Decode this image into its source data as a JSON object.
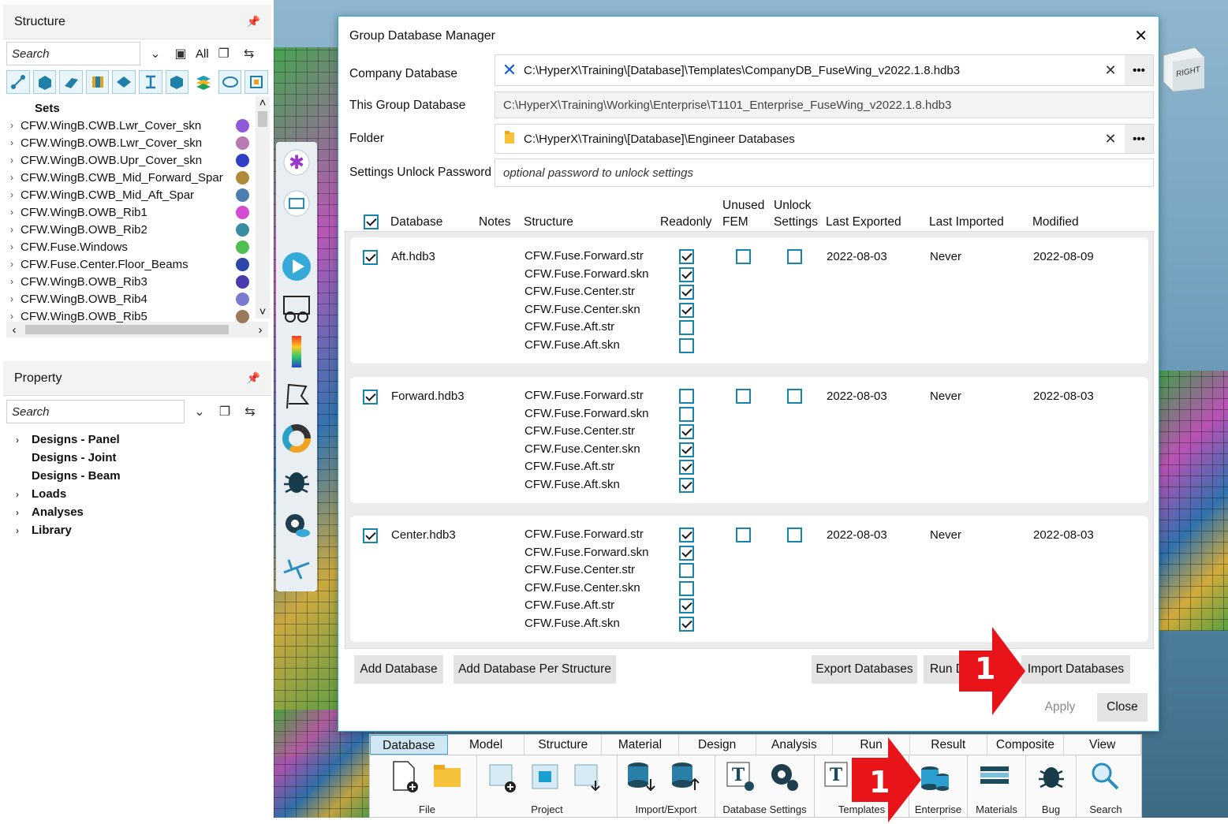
{
  "structure_panel": {
    "title": "Structure",
    "search_placeholder": "Search",
    "filter_label": "All",
    "tree": [
      {
        "label": "Sets",
        "bold": true,
        "expandable": false,
        "color": ""
      },
      {
        "label": "CFW.WingB.CWB.Lwr_Cover_skn",
        "color": "#8e5ad8"
      },
      {
        "label": "CFW.WingB.OWB.Lwr_Cover_skn",
        "color": "#b87ab0"
      },
      {
        "label": "CFW.WingB.OWB.Upr_Cover_skn",
        "color": "#2f3fc8"
      },
      {
        "label": "CFW.WingB.CWB_Mid_Forward_Spar",
        "color": "#b08a3a"
      },
      {
        "label": "CFW.WingB.CWB_Mid_Aft_Spar",
        "color": "#4d7eb0"
      },
      {
        "label": "CFW.WingB.OWB_Rib1",
        "color": "#d44ad0"
      },
      {
        "label": "CFW.WingB.OWB_Rib2",
        "color": "#3a8ea0"
      },
      {
        "label": "CFW.Fuse.Windows",
        "color": "#4fc04f"
      },
      {
        "label": "CFW.Fuse.Center.Floor_Beams",
        "color": "#2b45a8"
      },
      {
        "label": "CFW.WingB.OWB_Rib3",
        "color": "#4a3ab0"
      },
      {
        "label": "CFW.WingB.OWB_Rib4",
        "color": "#7a7ad0"
      },
      {
        "label": "CFW.WingB.OWB_Rib5",
        "color": "#9a7a5a"
      }
    ]
  },
  "property_panel": {
    "title": "Property",
    "search_placeholder": "Search",
    "tree": [
      {
        "label": "Designs - Panel",
        "expandable": true
      },
      {
        "label": "Designs - Joint",
        "expandable": false
      },
      {
        "label": "Designs - Beam",
        "expandable": false
      },
      {
        "label": "Loads",
        "expandable": true
      },
      {
        "label": "Analyses",
        "expandable": true
      },
      {
        "label": "Library",
        "expandable": true
      }
    ]
  },
  "dialog": {
    "title": "Group Database Manager",
    "company_db_label": "Company Database",
    "company_db_value": "C:\\HyperX\\Training\\[Database]\\Templates\\CompanyDB_FuseWing_v2022.1.8.hdb3",
    "group_db_label": "This Group Database",
    "group_db_value": "C:\\HyperX\\Training\\Working\\Enterprise\\T1101_Enterprise_FuseWing_v2022.1.8.hdb3",
    "folder_label": "Folder",
    "folder_value": "C:\\HyperX\\Training\\[Database]\\Engineer Databases",
    "password_label": "Settings Unlock Password",
    "password_placeholder": "optional password to unlock settings",
    "columns": {
      "database": "Database",
      "notes": "Notes",
      "structure": "Structure",
      "readonly": "Readonly",
      "unused_top": "Unused",
      "unused_bottom": "FEM",
      "unlock_top": "Unlock",
      "unlock_bottom": "Settings",
      "last_exported": "Last Exported",
      "last_imported": "Last Imported",
      "modified": "Modified"
    },
    "rows": [
      {
        "checked": true,
        "name": "Aft.hdb3",
        "structures": [
          "CFW.Fuse.Forward.str",
          "CFW.Fuse.Forward.skn",
          "CFW.Fuse.Center.str",
          "CFW.Fuse.Center.skn",
          "CFW.Fuse.Aft.str",
          "CFW.Fuse.Aft.skn"
        ],
        "readonly": [
          true,
          true,
          true,
          true,
          false,
          false
        ],
        "unused_fem": false,
        "unlock_settings": false,
        "last_exported": "2022-08-03",
        "last_imported": "Never",
        "modified": "2022-08-09"
      },
      {
        "checked": true,
        "name": "Forward.hdb3",
        "structures": [
          "CFW.Fuse.Forward.str",
          "CFW.Fuse.Forward.skn",
          "CFW.Fuse.Center.str",
          "CFW.Fuse.Center.skn",
          "CFW.Fuse.Aft.str",
          "CFW.Fuse.Aft.skn"
        ],
        "readonly": [
          false,
          false,
          true,
          true,
          true,
          true
        ],
        "unused_fem": false,
        "unlock_settings": false,
        "last_exported": "2022-08-03",
        "last_imported": "Never",
        "modified": "2022-08-03"
      },
      {
        "checked": true,
        "name": "Center.hdb3",
        "structures": [
          "CFW.Fuse.Forward.str",
          "CFW.Fuse.Forward.skn",
          "CFW.Fuse.Center.str",
          "CFW.Fuse.Center.skn",
          "CFW.Fuse.Aft.str",
          "CFW.Fuse.Aft.skn"
        ],
        "readonly": [
          true,
          true,
          false,
          false,
          true,
          true
        ],
        "unused_fem": false,
        "unlock_settings": false,
        "last_exported": "2022-08-03",
        "last_imported": "Never",
        "modified": "2022-08-03"
      }
    ],
    "buttons": {
      "add_database": "Add Database",
      "add_per_structure": "Add Database Per Structure",
      "export": "Export Databases",
      "run": "Run D",
      "import": "Import Databases",
      "apply": "Apply",
      "close": "Close"
    }
  },
  "ribbon": {
    "tabs": [
      "Database",
      "Model",
      "Structure",
      "Material",
      "Design",
      "Analysis",
      "Run",
      "Result",
      "Composite",
      "View"
    ],
    "active_tab": "Database",
    "groups": [
      "File",
      "Project",
      "Import/Export",
      "Database Settings",
      "Templates",
      "Enterprise",
      "Materials",
      "Bug",
      "Search"
    ]
  },
  "view_cube_label": "RIGHT",
  "callout_number": "1",
  "colors": {
    "accent": "#1685ad",
    "callout": "#e8141a"
  }
}
